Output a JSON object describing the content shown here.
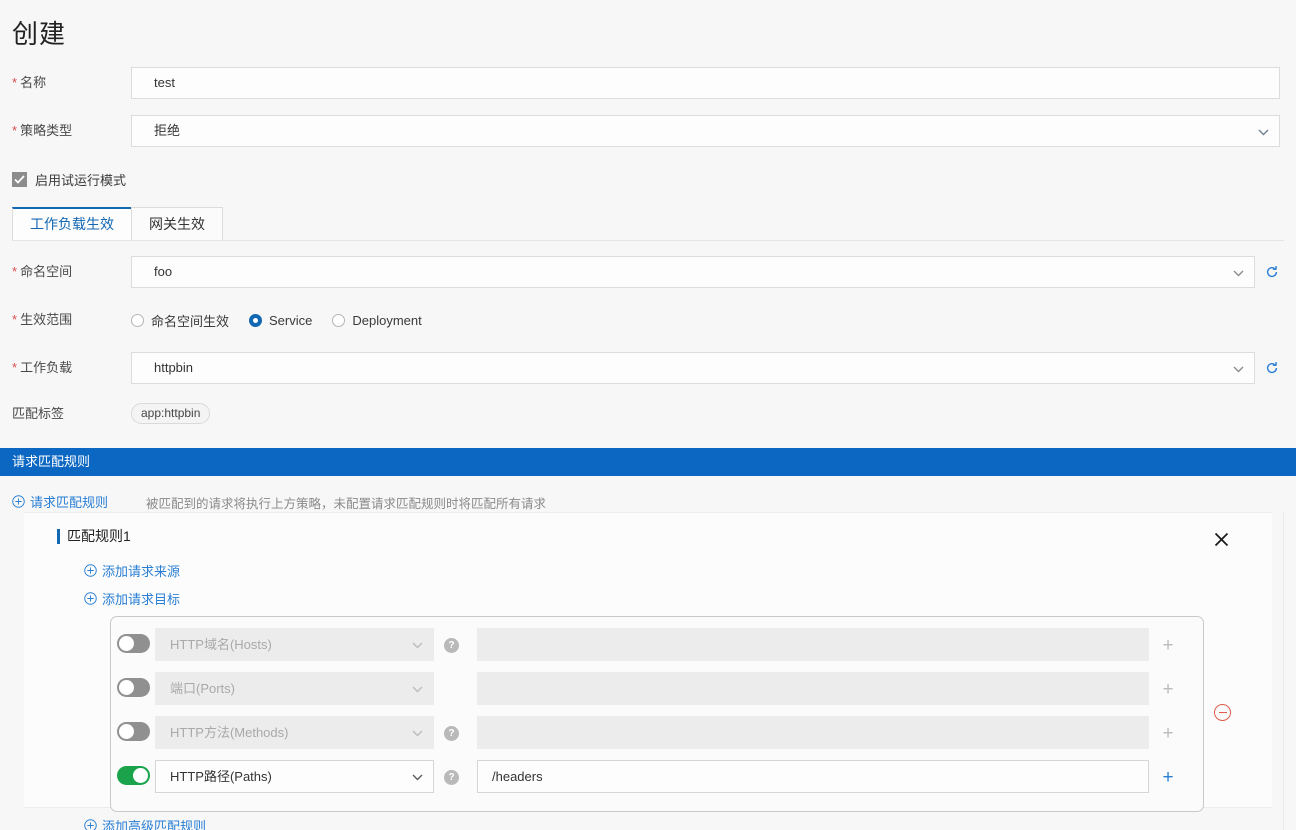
{
  "page": {
    "title": "创建"
  },
  "form": {
    "name": {
      "label": "名称",
      "required": true,
      "value": "test"
    },
    "policy_type": {
      "label": "策略类型",
      "required": true,
      "value": "拒绝"
    },
    "dry_run": {
      "label": "启用试运行模式",
      "checked": true
    }
  },
  "tabs": [
    {
      "label": "工作负载生效",
      "active": true
    },
    {
      "label": "网关生效",
      "active": false
    }
  ],
  "workload_tab": {
    "namespace": {
      "label": "命名空间",
      "required": true,
      "value": "foo"
    },
    "scope": {
      "label": "生效范围",
      "required": true,
      "options": [
        {
          "label": "命名空间生效",
          "selected": false
        },
        {
          "label": "Service",
          "selected": true
        },
        {
          "label": "Deployment",
          "selected": false
        }
      ]
    },
    "workload": {
      "label": "工作负载",
      "required": true,
      "value": "httpbin"
    },
    "match_label": {
      "label": "匹配标签",
      "tags": [
        "app:httpbin"
      ]
    }
  },
  "match_section": {
    "header": "请求匹配规则",
    "add_link": "请求匹配规则",
    "hint": "被匹配到的请求将执行上方策略，未配置请求匹配规则时将匹配所有请求",
    "rule": {
      "title": "匹配规则1",
      "add_source_link": "添加请求来源",
      "add_target_link": "添加请求目标",
      "rows": [
        {
          "type_label": "HTTP域名(Hosts)",
          "enabled": false,
          "has_help": true,
          "value": ""
        },
        {
          "type_label": "端口(Ports)",
          "enabled": false,
          "has_help": false,
          "value": ""
        },
        {
          "type_label": "HTTP方法(Methods)",
          "enabled": false,
          "has_help": true,
          "value": ""
        },
        {
          "type_label": "HTTP路径(Paths)",
          "enabled": true,
          "has_help": true,
          "value": "/headers"
        }
      ]
    },
    "advanced_link": "添加高级匹配规则"
  },
  "colors": {
    "accent_blue": "#0b67c2",
    "link_blue": "#2a7fd4",
    "toggle_green": "#1aa34a",
    "required_red": "#d94c4c",
    "danger_red": "#e05b4a"
  }
}
